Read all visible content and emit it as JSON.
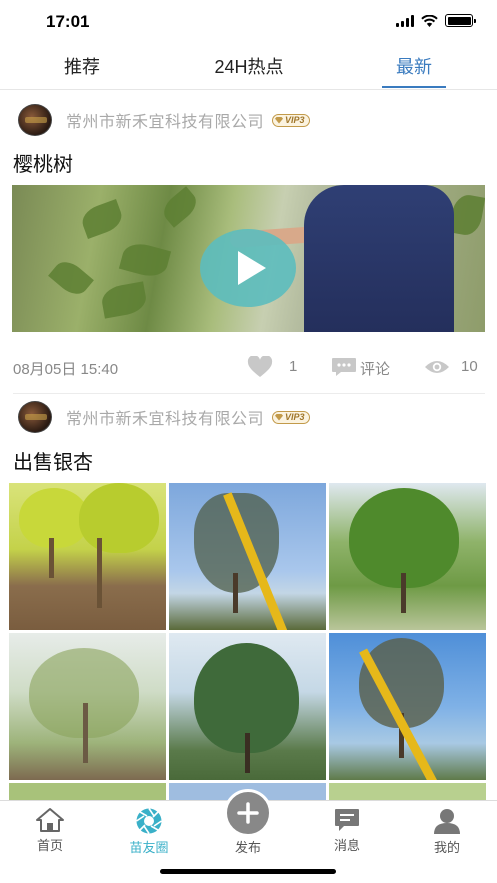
{
  "status_bar": {
    "time": "17:01",
    "signal_icon": "cellular-signal-icon",
    "wifi_icon": "wifi-icon",
    "battery_icon": "battery-icon"
  },
  "tabs": [
    {
      "label": "推荐",
      "active": false
    },
    {
      "label": "24H热点",
      "active": false
    },
    {
      "label": "最新",
      "active": true
    }
  ],
  "accent_color": "#3a7bbf",
  "posts": [
    {
      "company": "常州市新禾宜科技有限公司",
      "badge": "VIP3",
      "title": "樱桃树",
      "media": "video",
      "date": "08月05日 15:40",
      "likes": "1",
      "comment_label": "评论",
      "views": "10"
    },
    {
      "company": "常州市新禾宜科技有限公司",
      "badge": "VIP3",
      "title": "出售银杏",
      "media": "image-grid",
      "image_count": 6
    }
  ],
  "bottom_nav": [
    {
      "label": "首页",
      "icon": "home-icon",
      "active": false
    },
    {
      "label": "苗友圈",
      "icon": "aperture-icon",
      "active": true
    },
    {
      "label": "发布",
      "icon": "plus-icon",
      "active": false
    },
    {
      "label": "消息",
      "icon": "message-icon",
      "active": false
    },
    {
      "label": "我的",
      "icon": "profile-icon",
      "active": false
    }
  ],
  "active_nav_color": "#3ab0c8"
}
